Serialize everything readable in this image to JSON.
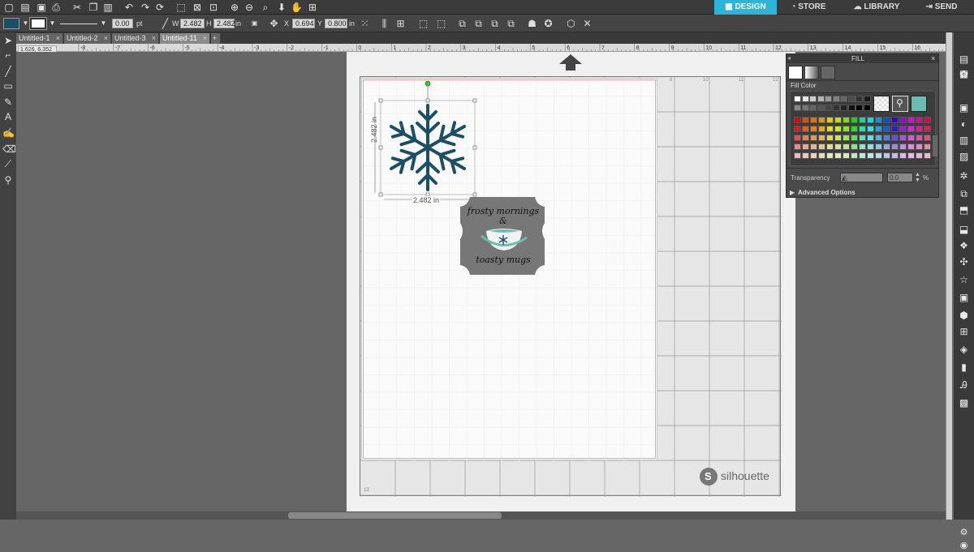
{
  "nav": {
    "design": "DESIGN",
    "store": "STORE",
    "library": "LIBRARY",
    "send": "SEND"
  },
  "toolbar": {
    "line_width": "0.00",
    "line_unit": "pt",
    "w_label": "W",
    "w_value": "2.482",
    "w_unit": "in",
    "h_label": "H",
    "h_value": "2.482",
    "h_unit": "in",
    "x_label": "X",
    "x_value": "0.694",
    "y_label": "Y",
    "y_value": "0.800",
    "y_unit": "in"
  },
  "tabs": [
    {
      "label": "Untitled-1"
    },
    {
      "label": "Untitled-2"
    },
    {
      "label": "Untitled-3"
    },
    {
      "label": "Untitled-11"
    }
  ],
  "coord_readout": "1.626, 6.352",
  "ruler_labels": [
    "-8",
    "-7",
    "-6",
    "-5",
    "-4",
    "-3",
    "-2",
    "-1",
    "0",
    "1",
    "2",
    "3",
    "4",
    "5",
    "6",
    "7",
    "8",
    "9",
    "10",
    "11",
    "12",
    "13",
    "14",
    "15",
    "16"
  ],
  "mat_inner_labels": [
    "8",
    "10",
    "11",
    "12",
    "13"
  ],
  "dimension_height": "2.482 in",
  "dimension_width": "2.482 in",
  "label_design": {
    "line1": "frosty mornings",
    "line2": "&",
    "line3": "toasty mugs"
  },
  "watermark": "silhouette",
  "fill_panel": {
    "title": "FILL",
    "section": "Fill Color",
    "transparency_label": "Transparency",
    "transparency_value": "0.0",
    "percent": "%",
    "advanced": "Advanced Options"
  },
  "colors": {
    "accent": "#2bb5d8",
    "snowflake": "#1a4f66",
    "label_grey": "#777777",
    "cup_teal": "#6bbdb2"
  }
}
